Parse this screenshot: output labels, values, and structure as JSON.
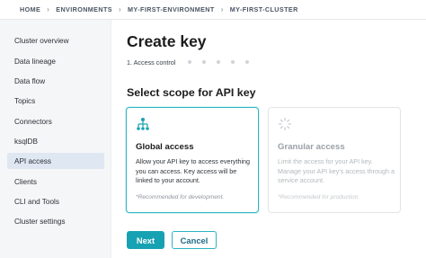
{
  "breadcrumb": {
    "items": [
      "HOME",
      "ENVIRONMENTS",
      "MY-FIRST-ENVIRONMENT",
      "MY-FIRST-CLUSTER"
    ],
    "separator": "›"
  },
  "sidebar": {
    "items": [
      {
        "label": "Cluster overview",
        "active": false
      },
      {
        "label": "Data lineage",
        "active": false
      },
      {
        "label": "Data flow",
        "active": false
      },
      {
        "label": "Topics",
        "active": false
      },
      {
        "label": "Connectors",
        "active": false
      },
      {
        "label": "ksqlDB",
        "active": false
      },
      {
        "label": "API access",
        "active": true
      },
      {
        "label": "Clients",
        "active": false
      },
      {
        "label": "CLI and Tools",
        "active": false
      },
      {
        "label": "Cluster settings",
        "active": false
      }
    ]
  },
  "main": {
    "title": "Create key",
    "step_label": "1. Access control",
    "subtitle": "Select scope for API key",
    "cards": [
      {
        "title": "Global access",
        "description": "Allow your API key to access everything you can access. Key access will be linked to your account.",
        "note": "*Recommended for development.",
        "icon": "hierarchy-icon",
        "selected": true
      },
      {
        "title": "Granular access",
        "description": "Limit the access for your API key. Manage your API key's access through a service account.",
        "note": "*Recommended for production.",
        "icon": "spinner-icon",
        "selected": false
      }
    ],
    "buttons": {
      "next": "Next",
      "cancel": "Cancel"
    }
  },
  "colors": {
    "accent": "#17a2b3",
    "selected_border": "#2bb5c2",
    "sidebar_active": "#dfe7f3",
    "sidebar_bg": "#f5f6f7"
  }
}
